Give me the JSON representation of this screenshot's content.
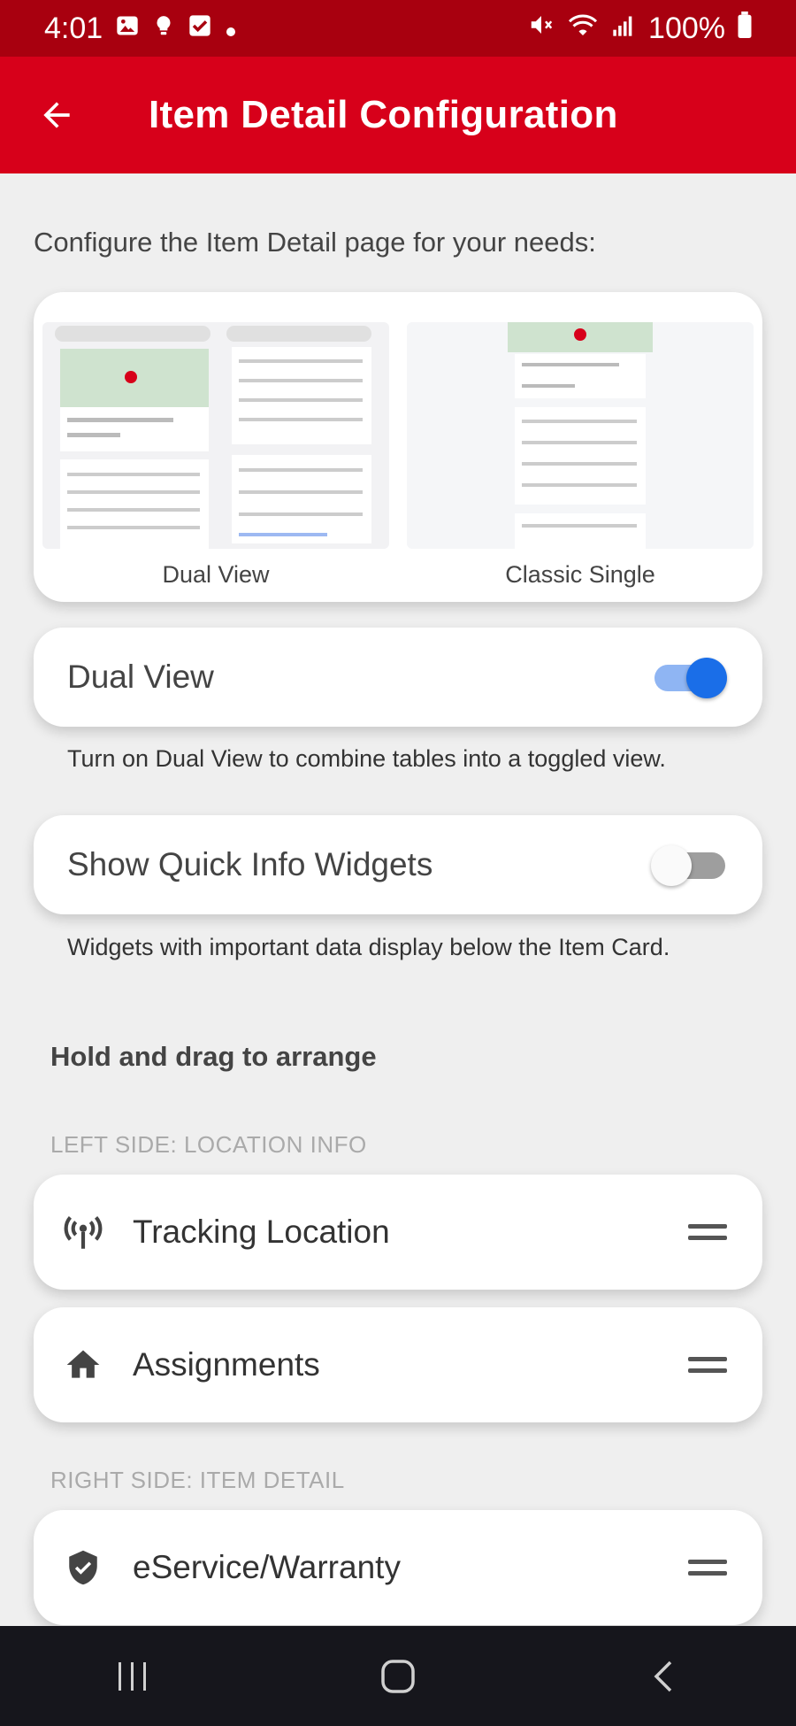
{
  "status_bar": {
    "time": "4:01",
    "battery": "100%",
    "icons_left": [
      "gallery-icon",
      "bulb-icon",
      "checkbox-icon",
      "dot-icon"
    ],
    "icons_right": [
      "mute-icon",
      "wifi-icon",
      "signal-icon",
      "battery-icon"
    ]
  },
  "app_bar": {
    "title": "Item Detail Configuration",
    "back_icon": "arrow-back-icon",
    "background": "#d7001a"
  },
  "intro_text": "Configure the Item Detail page for your needs:",
  "preview": {
    "options": [
      {
        "label": "Dual View"
      },
      {
        "label": "Classic Single"
      }
    ]
  },
  "dual_view": {
    "label": "Dual View",
    "enabled": true,
    "helper": "Turn on Dual View to combine tables into a toggled view.",
    "accent": "#1a6ee8"
  },
  "quick_info": {
    "label": "Show Quick Info Widgets",
    "enabled": false,
    "helper": "Widgets with important data display below the Item Card."
  },
  "arrange": {
    "title": "Hold and drag to arrange",
    "left_section": "LEFT SIDE: LOCATION INFO",
    "left_items": [
      {
        "label": "Tracking Location",
        "icon": "tracking-antenna-icon"
      },
      {
        "label": "Assignments",
        "icon": "home-icon"
      }
    ],
    "right_section": "RIGHT SIDE: ITEM DETAIL",
    "right_items": [
      {
        "label": "eService/Warranty",
        "icon": "shield-check-icon"
      }
    ]
  },
  "nav_bar": {
    "buttons": [
      "recent-apps-icon",
      "home-button-icon",
      "back-nav-icon"
    ]
  }
}
